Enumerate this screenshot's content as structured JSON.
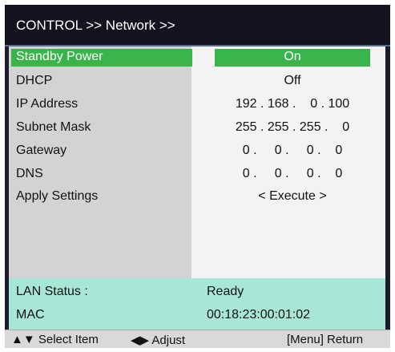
{
  "header": {
    "title": "CONTROL >> Network >>"
  },
  "rows": [
    {
      "label": "Standby Power",
      "value": "On"
    },
    {
      "label": "DHCP",
      "value": "Off"
    },
    {
      "label": "IP Address",
      "value": "192 . 168 .    0 . 100"
    },
    {
      "label": "Subnet Mask",
      "value": "255 . 255 . 255 .    0"
    },
    {
      "label": "Gateway",
      "value": "0 .     0 .     0 .    0"
    },
    {
      "label": "DNS",
      "value": "0 .     0 .     0 .    0"
    },
    {
      "label": "Apply Settings",
      "value": "< Execute >"
    }
  ],
  "status": {
    "lan_label": "LAN Status :",
    "lan_value": "Ready",
    "mac_label": "MAC",
    "mac_value": "00:18:23:00:01:02"
  },
  "footer": {
    "select": "▲▼ Select Item",
    "adjust": "◀▶ Adjust",
    "return": "[Menu] Return"
  },
  "colors": {
    "highlight": "#39b44a",
    "status_bg": "#a8e6d6",
    "header_bg": "#13131f"
  }
}
